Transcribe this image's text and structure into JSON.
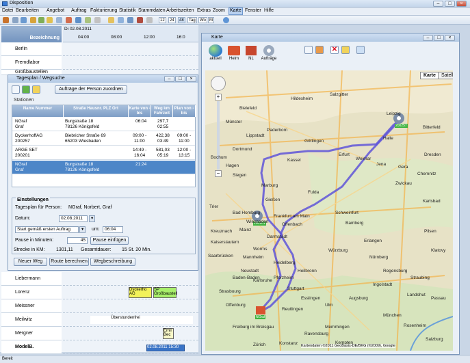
{
  "window": {
    "title": "Disposition"
  },
  "menu": [
    "Datei",
    "Bearbeiten",
    "Angebot",
    "Auftrag",
    "Fakturierung",
    "Statistik",
    "Stammdaten",
    "Arbeitszeiten",
    "Extras",
    "Zoom",
    "Karte",
    "Fenster",
    "Hilfe"
  ],
  "toolbar": {
    "n1": "12",
    "n2": "24",
    "n3": "48",
    "n4": "Tag",
    "n5": "Wo",
    "n6": "M"
  },
  "schedule": {
    "header": "Bezeichnung",
    "date": "Di 02.08.2011",
    "times": [
      "04:00",
      "08:00",
      "12:00",
      "16:0"
    ],
    "persons_top": [
      "Berlin",
      "Fremdlabor",
      "Großbaustellen"
    ],
    "persons_bottom": [
      "Liebermann",
      "Lorenz",
      "Meissner",
      "Meilwitz",
      "Mergner",
      "ModelB."
    ],
    "events": {
      "e1": "Dyckerho AG",
      "e2": "SP Großbaustell",
      "e3": "Überstundenfrei",
      "e4": "Emil Bec",
      "e5": "02.08.2011 15:30"
    }
  },
  "tagesplan": {
    "title": "Tagesplan / Wegsuche",
    "assign_button": "Aufträge der Person zuordnen",
    "stations_label": "Stationen",
    "columns": [
      "Name Nummer",
      "Straße Hausnr. PLZ Ort",
      "Karte von - bis",
      "Weg km Fahrzeit",
      "Plan von - bis"
    ],
    "rows": [
      {
        "name": "NGraf",
        "num": "Graf",
        "str": "Burgstraße 18",
        "ort": "78126 Königsfeld",
        "k1": "06:04",
        "k2": "",
        "w1": "297,7",
        "w2": "02:55",
        "p1": "",
        "p2": ""
      },
      {
        "name": "DyckerhoffAG",
        "num": "200257",
        "str": "Biebricher Straße 69",
        "ort": "65203 Wiesbaden",
        "k1": "09:00 -",
        "k2": "11:00",
        "w1": "422,38",
        "w2": "03:49",
        "p1": "09:00 -",
        "p2": "11:00"
      },
      {
        "name": "ARGE SET",
        "num": "200201",
        "str": "",
        "ort": "",
        "k1": "14:49 -",
        "k2": "16:04",
        "w1": "581,03",
        "w2": "05:19",
        "p1": "12:00 -",
        "p2": "13:15"
      },
      {
        "name": "NGraf",
        "num": "Graf",
        "str": "Burgstraße 18",
        "ort": "78126 Königsfeld",
        "k1": "21:24",
        "k2": "",
        "w1": "",
        "w2": "",
        "p1": "",
        "p2": ""
      }
    ],
    "settings": {
      "title": "Einstellungen",
      "person_label": "Tagesplan für Person:",
      "person_value": "NGraf, Norbert, Graf",
      "date_label": "Datum:",
      "date_value": "02.08.2011",
      "start_value": "Start gemäß ersten Auftrag",
      "um_label": "um:",
      "um_value": "06:04",
      "pause_label": "Pause in Minuten:",
      "pause_value": "45",
      "pause_button": "Pause einfügen",
      "km_label": "Strecke in KM:",
      "km_value": "1301,11",
      "total_label": "Gesamtdauer:",
      "total_value": "15 St. 20 Min."
    },
    "buttons": {
      "new": "Neuer Weg",
      "calc": "Route berechnen",
      "desc": "Wegbeschreibung"
    }
  },
  "karte": {
    "title": "Karte",
    "tools": [
      "aktuell",
      "Heim",
      "NL",
      "Aufträge"
    ],
    "maptypes": [
      "Karte",
      "Satellit"
    ],
    "cities": [
      "Bielefeld",
      "Hildesheim",
      "Salzgitter",
      "Paderborn",
      "Göttingen",
      "Lippstadt",
      "Kassel",
      "Halle",
      "Leipzig",
      "Bitterfeld",
      "Erfurt",
      "Weimar",
      "Jena",
      "Gera",
      "Dresden",
      "Chemnitz",
      "Zwickau",
      "Siegen",
      "Marburg",
      "Gießen",
      "Fulda",
      "Bad Homburg",
      "Frankfurt am Main",
      "Offenbach",
      "Darmstadt",
      "Mainz",
      "Wiesbaden",
      "Worms",
      "Mannheim",
      "Heidelberg",
      "Würzburg",
      "Bamberg",
      "Erlangen",
      "Nürnberg",
      "Neustadt",
      "Heilbronn",
      "Karlsruhe",
      "Pforzheim",
      "Stuttgart",
      "Esslingen",
      "Reutlingen",
      "Ulm",
      "Augsburg",
      "München",
      "Rosenheim",
      "Regensburg",
      "Ingolstadt",
      "Straubing",
      "Landshut",
      "Passau",
      "Salzburg",
      "Strasbourg",
      "Freiburg im Breisgau",
      "Baden-Baden",
      "Offenburg",
      "Memmingen",
      "Kempten",
      "Ravensburg",
      "Konstanz",
      "Zürich",
      "Schweinfurt",
      "Kaiserslautern",
      "Kreuznach",
      "Trier",
      "Saarbrücken",
      "Karlsbad",
      "Pilsen",
      "Klatovy",
      "Dortmund",
      "Münster",
      "Bochum",
      "Hagen"
    ],
    "copyright": "Kartendaten ©2011 GeoBasis-DE/BKG (©2009), Google",
    "labels": {
      "pin_home": "NGraf",
      "pin_a": "200257",
      "pin_b": "200201"
    }
  },
  "status": {
    "text": "Bereit"
  }
}
